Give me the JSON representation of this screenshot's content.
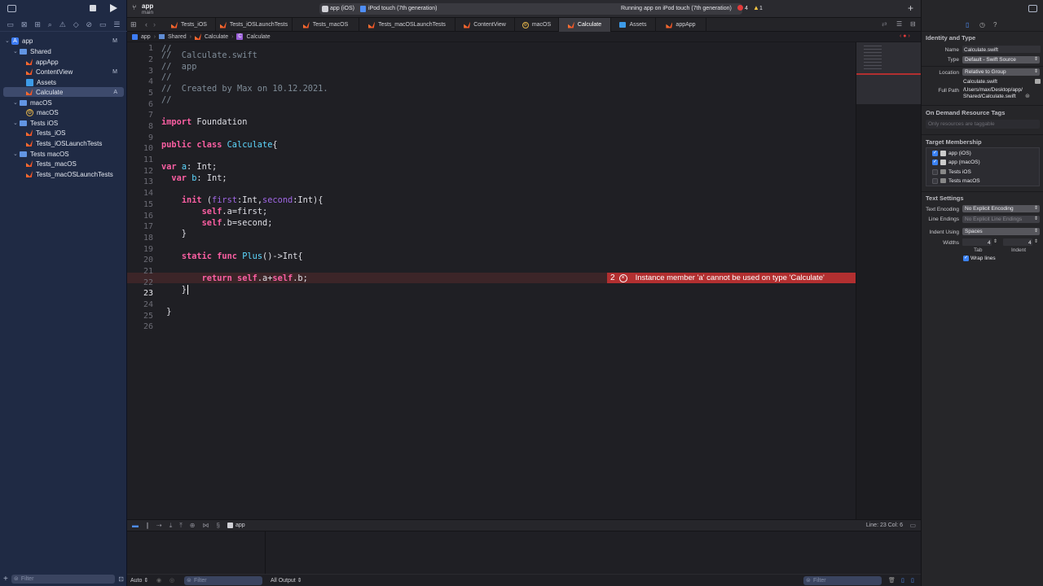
{
  "app": {
    "scheme_title": "app",
    "branch": "main"
  },
  "toolbar": {
    "scheme": "app (iOS)",
    "device": "iPod touch (7th generation)",
    "status": "Running app on iPod touch (7th generation)",
    "error_count": "4",
    "warning_count": "1"
  },
  "tabs": [
    "Tests_iOS",
    "Tests_iOSLaunchTests",
    "Tests_macOS",
    "Tests_macOSLaunchTests",
    "ContentView",
    "macOS",
    "Calculate",
    "Assets",
    "appApp"
  ],
  "breadcrumb": [
    "app",
    "Shared",
    "Calculate",
    "Calculate"
  ],
  "navigator": {
    "items": [
      {
        "label": "app",
        "badge": "M"
      },
      {
        "label": "Shared",
        "badge": ""
      },
      {
        "label": "appApp",
        "badge": ""
      },
      {
        "label": "ContentView",
        "badge": "M"
      },
      {
        "label": "Assets",
        "badge": ""
      },
      {
        "label": "Calculate",
        "badge": "A"
      },
      {
        "label": "macOS",
        "badge": ""
      },
      {
        "label": "macOS",
        "badge": ""
      },
      {
        "label": "Tests iOS",
        "badge": ""
      },
      {
        "label": "Tests_iOS",
        "badge": ""
      },
      {
        "label": "Tests_iOSLaunchTests",
        "badge": ""
      },
      {
        "label": "Tests macOS",
        "badge": ""
      },
      {
        "label": "Tests_macOS",
        "badge": ""
      },
      {
        "label": "Tests_macOSLaunchTests",
        "badge": ""
      }
    ],
    "filter_placeholder": "Filter"
  },
  "editor": {
    "line_numbers": [
      "1",
      "2",
      "3",
      "4",
      "5",
      "6",
      "7",
      "8",
      "9",
      "10",
      "11",
      "12",
      "13",
      "14",
      "15",
      "16",
      "17",
      "18",
      "19",
      "20",
      "21",
      "22",
      "23",
      "24",
      "25",
      "26"
    ],
    "error": {
      "count": "2",
      "message": "Instance member 'a' cannot be used on type 'Calculate'"
    }
  },
  "debug": {
    "target": "app",
    "cursor": "Line: 23  Col: 6"
  },
  "console": {
    "auto": "Auto ⇕",
    "filter": "Filter",
    "output": "All Output ⇕",
    "filter_right": "Filter"
  },
  "inspector": {
    "identity_title": "Identity and Type",
    "name_label": "Name",
    "name_value": "Calculate.swift",
    "type_label": "Type",
    "type_value": "Default - Swift Source",
    "location_label": "Location",
    "location_value": "Relative to Group",
    "location_file": "Calculate.swift",
    "fullpath_label": "Full Path",
    "fullpath_value1": "/Users/max/Desktop/app/",
    "fullpath_value2": "Shared/Calculate.swift",
    "odr_title": "On Demand Resource Tags",
    "odr_placeholder": "Only resources are taggable",
    "target_title": "Target Membership",
    "targets": [
      {
        "label": "app (iOS)",
        "checked": true
      },
      {
        "label": "app (macOS)",
        "checked": true
      },
      {
        "label": "Tests iOS",
        "checked": false
      },
      {
        "label": "Tests macOS",
        "checked": false
      }
    ],
    "text_title": "Text Settings",
    "encoding_label": "Text Encoding",
    "encoding_value": "No Explicit Encoding",
    "endings_label": "Line Endings",
    "endings_value": "No Explicit Line Endings",
    "indent_label": "Indent Using",
    "indent_value": "Spaces",
    "widths_label": "Widths",
    "tab_value": "4",
    "indent_value_num": "4",
    "tab_caption": "Tab",
    "indent_caption": "Indent",
    "wrap_label": "Wrap lines"
  }
}
